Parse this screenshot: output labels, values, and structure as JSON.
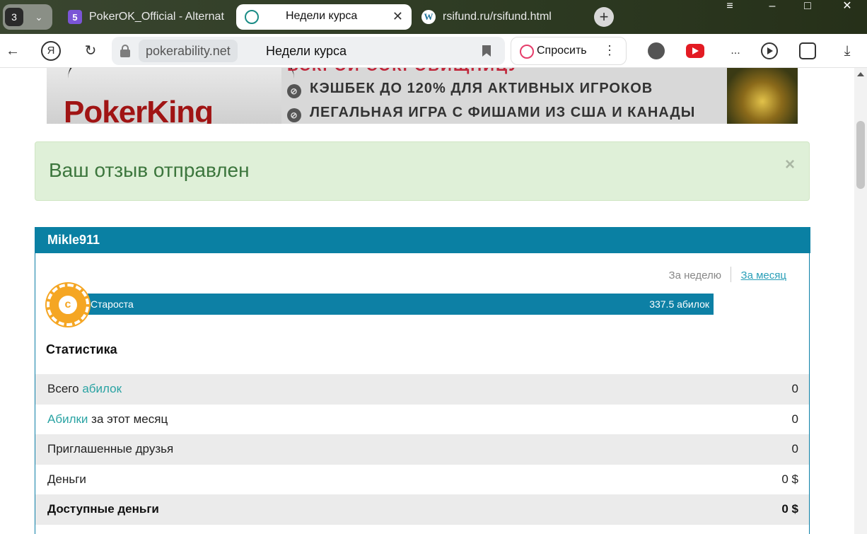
{
  "browser": {
    "tab_count": "3",
    "tabs": [
      {
        "title": "PokerOK_Official - Alternat",
        "favicon": "html5-icon"
      },
      {
        "title": "Недели курса",
        "favicon": "pokerability-icon",
        "active": true
      },
      {
        "title": "rsifund.ru/rsifund.html",
        "favicon": "wordpress-icon"
      }
    ],
    "address": {
      "domain": "pokerability.net",
      "page_title": "Недели курса"
    },
    "ask_label": "Спросить",
    "ext_dots": "..."
  },
  "banner": {
    "brand": "PokerKing",
    "topline": "ВСКРОЙ СОКРОВИЩНИЦУ",
    "lines": [
      "КЭШБЕК ДО 120% ДЛЯ АКТИВНЫХ ИГРОКОВ",
      "ЛЕГАЛЬНАЯ ИГРА С ФИШАМИ ИЗ США И КАНАДЫ"
    ]
  },
  "alert": {
    "message": "Ваш отзыв отправлен",
    "close": "×"
  },
  "profile": {
    "username": "Mikle911",
    "period_week": "За неделю",
    "period_month": "За месяц",
    "rank": {
      "chip_letter": "c",
      "name": "Староста",
      "value": "337.5 абилок",
      "progress": 1.0
    },
    "stats_title": "Статистика",
    "stats": [
      {
        "label_pre": "Всего ",
        "label_link": "абилок",
        "label_post": "",
        "value": "0"
      },
      {
        "label_pre": "",
        "label_link": "Абилки",
        "label_post": " за этот месяц",
        "value": "0"
      },
      {
        "label_pre": "Приглашенные друзья",
        "label_link": "",
        "label_post": "",
        "value": "0"
      },
      {
        "label_pre": "Деньги",
        "label_link": "",
        "label_post": "",
        "value": "0 $"
      },
      {
        "label_pre": "Доступные деньги",
        "label_link": "",
        "label_post": "",
        "value": "0 $",
        "bold": true
      }
    ]
  },
  "colors": {
    "panel_header": "#0a80a3",
    "alert_bg": "#dff0d8",
    "alert_text": "#3c763d",
    "link": "#2aa3a3",
    "chip": "#f5a623"
  }
}
